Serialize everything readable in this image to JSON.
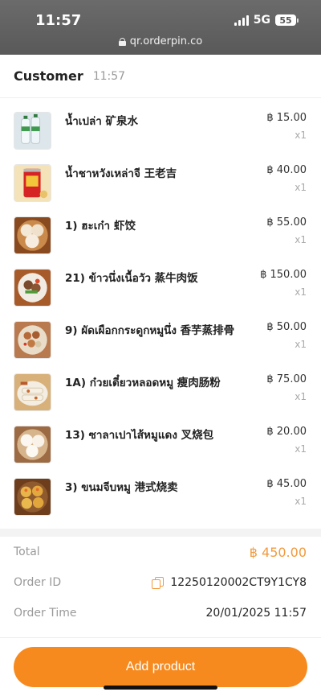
{
  "status_bar": {
    "time": "11:57",
    "network": "5G",
    "battery": "55"
  },
  "browser": {
    "url": "qr.orderpin.co"
  },
  "header": {
    "title": "Customer",
    "time": "11:57"
  },
  "items": [
    {
      "name": "น้ำเปล่า 矿泉水",
      "price": "฿ 15.00",
      "qty": "x1",
      "thumb": "water-bottles-photo"
    },
    {
      "name": "น้ำชาหวังเหล่าจี 王老吉",
      "price": "฿ 40.00",
      "qty": "x1",
      "thumb": "red-tea-can-photo"
    },
    {
      "name": "1) ฮะเก๋า 虾饺",
      "price": "฿ 55.00",
      "qty": "x1",
      "thumb": "shrimp-dumplings-photo"
    },
    {
      "name": "21) ข้าวนึ่งเนื้อวัว 蒸牛肉饭",
      "price": "฿ 150.00",
      "qty": "x1",
      "thumb": "steamed-beef-rice-photo"
    },
    {
      "name": "9) ผัดเผือกกระดูกหมูนึ่ง 香芋蒸排骨",
      "price": "฿ 50.00",
      "qty": "x1",
      "thumb": "pork-ribs-taro-photo"
    },
    {
      "name": "1A) ก๋วยเตี๋ยวหลอดหมู 瘦肉肠粉",
      "price": "฿ 75.00",
      "qty": "x1",
      "thumb": "rice-noodle-roll-photo"
    },
    {
      "name": "13) ซาลาเปาไส้หมูแดง 叉烧包",
      "price": "฿ 20.00",
      "qty": "x1",
      "thumb": "char-siu-bao-photo"
    },
    {
      "name": "3) ขนมจีบหมู 港式烧卖",
      "price": "฿ 45.00",
      "qty": "x1",
      "thumb": "siu-mai-photo"
    }
  ],
  "summary": {
    "total_label": "Total",
    "total_value": "฿ 450.00",
    "order_id_label": "Order ID",
    "order_id_value": "12250120002CT9Y1CY8",
    "order_time_label": "Order Time",
    "order_time_value": "20/01/2025 11:57"
  },
  "actions": {
    "add_product_label": "Add product"
  },
  "colors": {
    "accent": "#f68a1f",
    "total_text": "#f39a3d"
  }
}
